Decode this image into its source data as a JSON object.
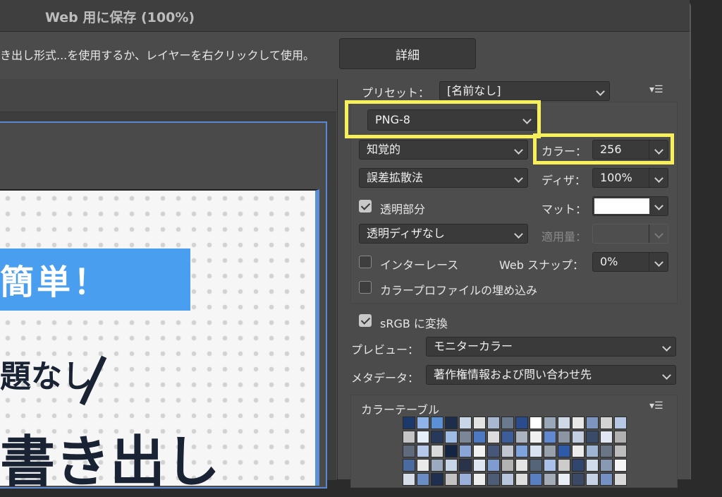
{
  "window": {
    "title": "Web 用に保存 (100%)"
  },
  "info": {
    "text": "き出し形式...を使用するか、レイヤーを右クリックして使用。",
    "detail_button": "詳細"
  },
  "preview": {
    "banner": "簡単！",
    "mid_text": "題なし",
    "big_text": "書き出し"
  },
  "settings": {
    "preset_label": "プリセット：",
    "preset_value": "[名前なし]",
    "format_value": "PNG-8",
    "reduction_value": "知覚的",
    "colors_label": "カラー：",
    "colors_value": "256",
    "dither_method": "誤差拡散法",
    "dither_label": "ディザ：",
    "dither_value": "100%",
    "transparency_label": "透明部分",
    "transparency_checked": true,
    "matte_label": "マット：",
    "matte_color": "#ffffff",
    "transparency_dither": "透明ディザなし",
    "amount_label": "適用量：",
    "amount_value": "",
    "interlace_label": "インターレース",
    "interlace_checked": false,
    "websnap_label": "Web スナップ：",
    "websnap_value": "0%",
    "embed_profile_label": "カラープロファイルの埋め込み",
    "embed_profile_checked": false,
    "srgb_label": "sRGB に変換",
    "srgb_checked": true,
    "preview_label": "プレビュー：",
    "preview_value": "モニターカラー",
    "metadata_label": "メタデータ：",
    "metadata_value": "著作権情報および問い合わせ先"
  },
  "color_table": {
    "label": "カラーテーブル",
    "swatches": [
      "#1b3a6b",
      "#8fb3e8",
      "#5b8fd6",
      "#1e2d4a",
      "#c9d6e8",
      "#e3e3e3",
      "#a8b8d0",
      "#6b7a8f",
      "#2a4c8c",
      "#ffffff",
      "#9aa7b8",
      "#cfd9e6",
      "#e8e8e8",
      "#7c96c0",
      "#d4d4d4",
      "#b7c8e4",
      "#c5c5c5",
      "#e6eefa",
      "#27385a",
      "#9ebbe3",
      "#7d8696",
      "#4d79c2",
      "#dcdcdc",
      "#3c5d99",
      "#aab3bf",
      "#f0f0f0",
      "#6189d0",
      "#8c95a3",
      "#c3cfe0",
      "#3a4b6a",
      "#e0e7f2",
      "#b0b0b0",
      "#5f6b7d",
      "#b6c9ea",
      "#dadada",
      "#142544",
      "#8aa6d6",
      "#f2f2f2",
      "#465779",
      "#c0c7d1",
      "#7fa3dd",
      "#d8e2f0",
      "#99a1ad",
      "#2f5aa8",
      "#ececec",
      "#a0b4d4",
      "#6a7585",
      "#bdbdbd",
      "#4b6aa0",
      "#eaeaea",
      "#9caac0",
      "#c8d4e8",
      "#29344a",
      "#dfe6f1",
      "#7e9ccf",
      "#b3b3b3",
      "#e4e4e4",
      "#56647a",
      "#a9c1e8",
      "#cccccc",
      "#31466e",
      "#d0dbec",
      "#8899b3",
      "#f5f5f5",
      "#d6dde8",
      "#6c8cc4",
      "#1f2f50",
      "#c2c2c2",
      "#9ab0d8",
      "#ededed",
      "#4e5d75",
      "#b8c6dd",
      "#dedede",
      "#5a7fc0",
      "#a4acb8",
      "#e9eef6",
      "#394966",
      "#c6d2e6",
      "#7590c2",
      "#d9d9d9"
    ]
  }
}
